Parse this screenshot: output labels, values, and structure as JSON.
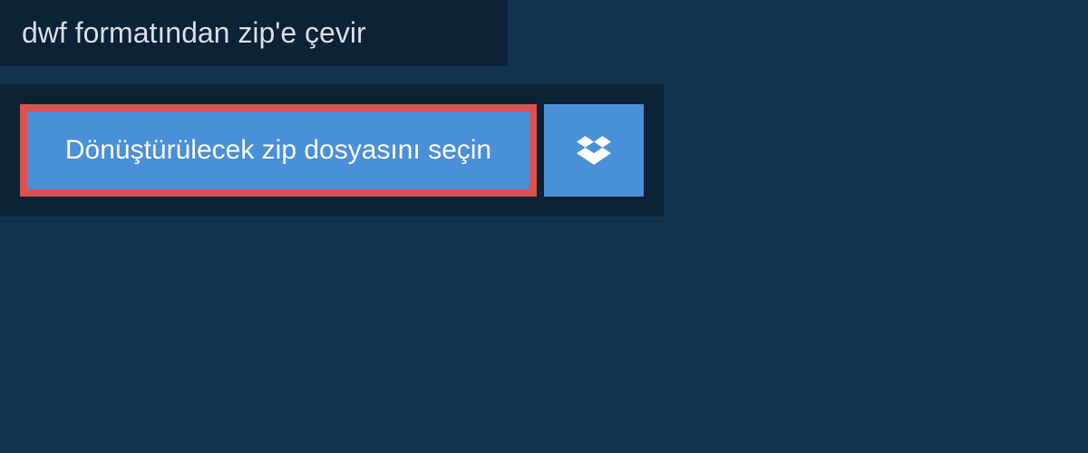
{
  "header": {
    "title": "dwf formatından zip'e çevir"
  },
  "upload": {
    "select_button_label": "Dönüştürülecek zip dosyasını seçin",
    "dropbox_icon": "dropbox"
  },
  "colors": {
    "background": "#13334d",
    "panel": "#0c2237",
    "button": "#4a90d9",
    "highlight_border": "#d9534f",
    "text_light": "#d8dde2",
    "text_white": "#ffffff"
  }
}
